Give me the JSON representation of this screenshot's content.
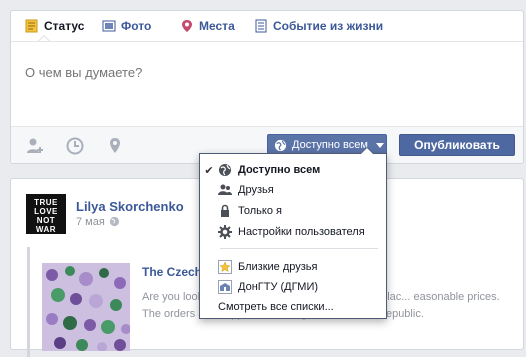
{
  "composer": {
    "tabs": [
      {
        "label": "Статус",
        "icon": "status-icon"
      },
      {
        "label": "Фото",
        "icon": "photo-icon"
      },
      {
        "label": "Места",
        "icon": "place-pin-icon"
      },
      {
        "label": "Событие из жизни",
        "icon": "life-event-icon"
      }
    ],
    "placeholder": "О чем вы думаете?",
    "privacy_label": "Доступно всем",
    "publish_label": "Опубликовать"
  },
  "audience_menu": {
    "items": [
      {
        "label": "Доступно всем",
        "icon": "globe-icon",
        "checked": true
      },
      {
        "label": "Друзья",
        "icon": "friends-icon"
      },
      {
        "label": "Только я",
        "icon": "lock-icon"
      },
      {
        "label": "Настройки пользователя",
        "icon": "gear-icon"
      }
    ],
    "lists": [
      {
        "label": "Близкие друзья",
        "icon": "star-list-icon"
      },
      {
        "label": "ДонГТУ (ДГМИ)",
        "icon": "school-list-icon"
      }
    ],
    "see_all": "Смотреть все списки..."
  },
  "post": {
    "author": "Lilya Skorchenko",
    "date": "7 мая",
    "avatar_text": "TRUE LOVE NOT WAR",
    "link_title": "The Czech",
    "link_desc": "Are you look... s? Czech Beads Shop is the right plac... easonable prices. The orders are shipped from Prague, the Czech Republic."
  },
  "colors": {
    "brand": "#3b5998",
    "button": "#4e69a2",
    "privacy_button": "#5b74a8"
  }
}
